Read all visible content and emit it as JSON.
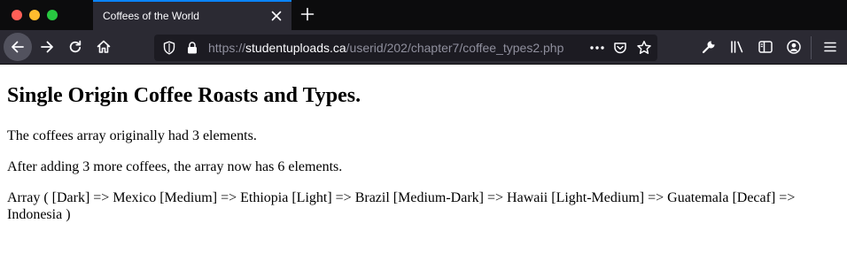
{
  "browser": {
    "tab": {
      "title": "Coffees of the World"
    },
    "url": {
      "scheme": "https://",
      "host": "studentuploads.ca",
      "path": "/userid/202/chapter7/coffee_types2.php"
    },
    "icons": {
      "window_controls": [
        "close-dot",
        "minimize-dot",
        "zoom-dot"
      ],
      "tab": [
        "close-icon",
        "plus-icon"
      ],
      "nav": [
        "back-arrow-icon",
        "forward-arrow-icon",
        "reload-icon",
        "home-icon"
      ],
      "urlbar": [
        "tracking-shield-icon",
        "lock-icon",
        "more-ellipsis-icon",
        "pocket-icon",
        "bookmark-star-icon"
      ],
      "toolbar_right": [
        "wrench-icon",
        "library-icon",
        "sidebar-icon",
        "account-icon",
        "hamburger-menu-icon"
      ]
    },
    "colors": {
      "tab_accent": "#0a84ff",
      "chrome_dark": "#0c0c0d",
      "toolbar": "#2b2a33",
      "urlbar": "#1c1b22"
    }
  },
  "page": {
    "heading": "Single Origin Coffee Roasts and Types.",
    "paragraphs": [
      "The coffees array originally had 3 elements.",
      "After adding 3 more coffees, the array now has 6 elements.",
      "Array ( [Dark] => Mexico [Medium] => Ethiopia [Light] => Brazil [Medium-Dark] => Hawaii [Light-Medium] => Guatemala [Decaf] => Indonesia )"
    ]
  }
}
